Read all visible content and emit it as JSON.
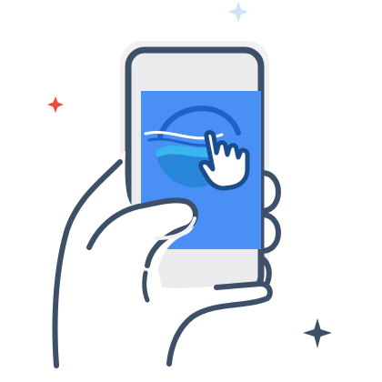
{
  "illustration": {
    "subject": "hand-holding-phone-tapping-app",
    "icons": [
      "sparkle-blue-icon",
      "sparkle-red-icon",
      "sparkle-dark-icon",
      "wave-logo-icon",
      "pointer-hand-icon"
    ]
  },
  "colors": {
    "outline": "#3d5068",
    "phone_shadow": "#f1f1f3",
    "phone_body": "#ebebee",
    "screen": "#4a8ff5",
    "logo_blue": "#1e61c7",
    "logo_light": "#37b6f0",
    "skin_shadow": "#f2f2f4",
    "sparkle_blue": "#cfe3f7",
    "sparkle_red": "#ee4b3b",
    "sparkle_dark": "#3d5068"
  }
}
